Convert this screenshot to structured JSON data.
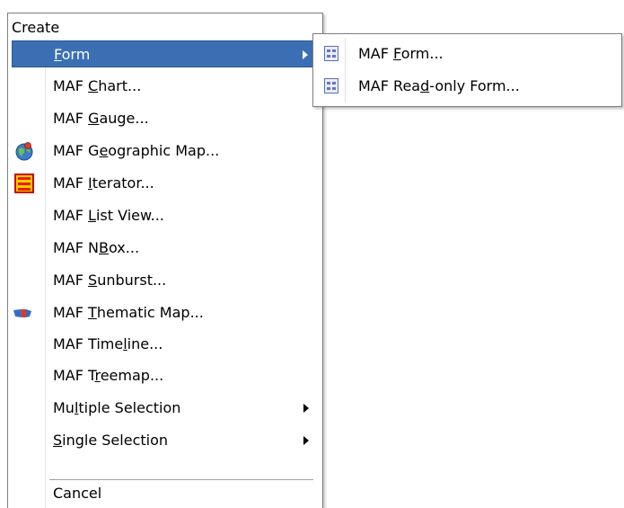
{
  "menu": {
    "header": "Create",
    "items": [
      {
        "label": "Form",
        "mnemonic_index": 0,
        "has_submenu": true,
        "selected": true,
        "icon": null
      },
      {
        "label": "MAF Chart...",
        "mnemonic_index": 4,
        "icon": null
      },
      {
        "label": "MAF Gauge...",
        "mnemonic_index": 4,
        "icon": null
      },
      {
        "label": "MAF Geographic Map...",
        "mnemonic_index": 5,
        "icon": "globe-icon"
      },
      {
        "label": "MAF Iterator...",
        "mnemonic_index": 4,
        "icon": "iterator-icon"
      },
      {
        "label": "MAF List View...",
        "mnemonic_index": 4,
        "icon": null
      },
      {
        "label": "MAF NBox...",
        "mnemonic_index": 5,
        "icon": null
      },
      {
        "label": "MAF Sunburst...",
        "mnemonic_index": 4,
        "icon": null
      },
      {
        "label": "MAF Thematic Map...",
        "mnemonic_index": 4,
        "icon": "thematic-map-icon"
      },
      {
        "label": "MAF Timeline...",
        "mnemonic_index": 8,
        "icon": null
      },
      {
        "label": "MAF Treemap...",
        "mnemonic_index": 5,
        "icon": null
      },
      {
        "label": "Multiple Selection",
        "mnemonic_index": 2,
        "has_submenu": true,
        "icon": null
      },
      {
        "label": "Single Selection",
        "mnemonic_index": 0,
        "has_submenu": true,
        "icon": null
      }
    ],
    "cancel": {
      "label": "Cancel",
      "mnemonic_index": -1
    }
  },
  "submenu": {
    "items": [
      {
        "label": "MAF Form...",
        "mnemonic_index": 4,
        "icon": "form-icon"
      },
      {
        "label": "MAF Read-only Form...",
        "mnemonic_index": 7,
        "icon": "form-icon"
      }
    ]
  },
  "colors": {
    "selection": "#3a6fb3",
    "menu_border": "#7f7f7f"
  }
}
